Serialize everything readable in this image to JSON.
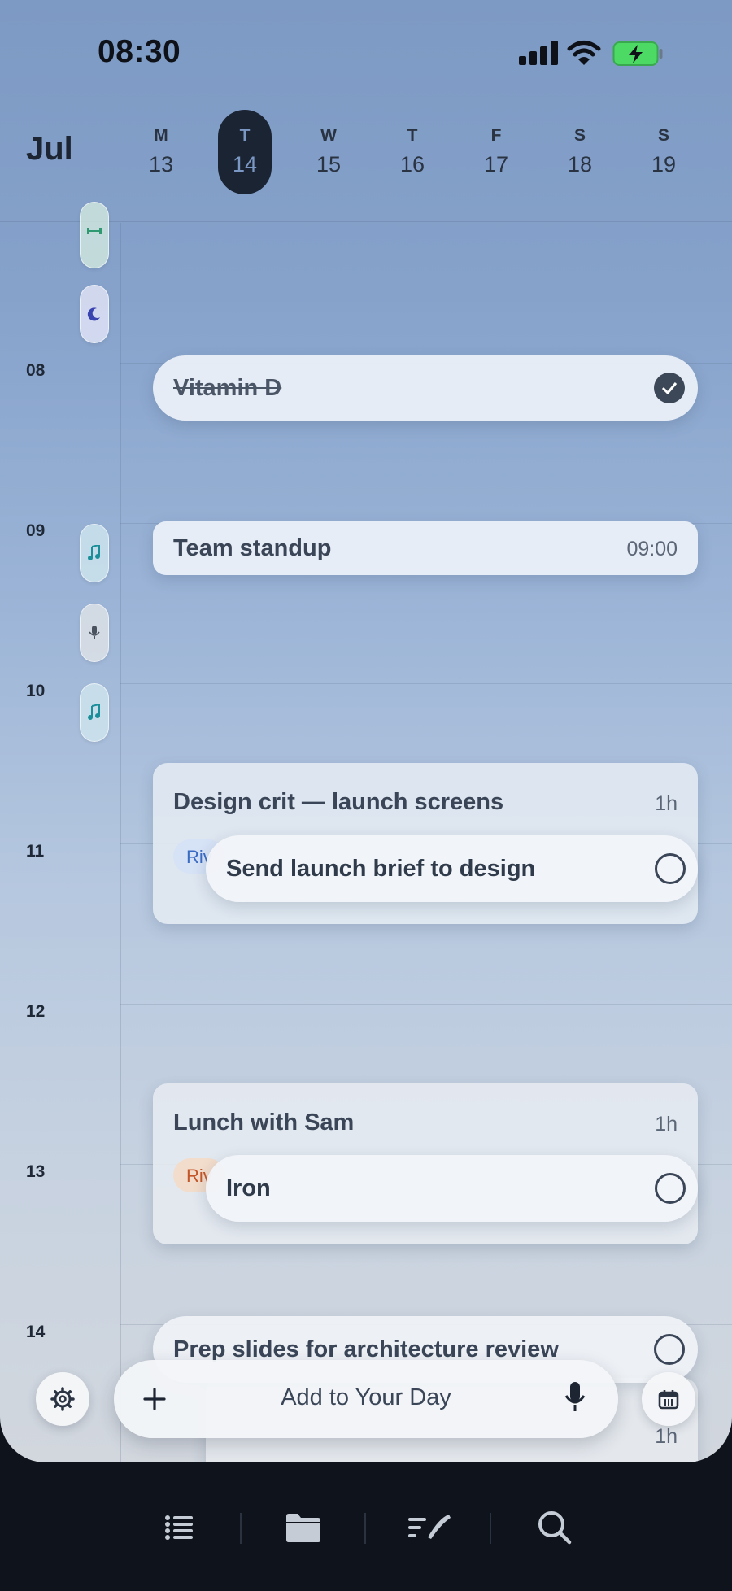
{
  "status_bar": {
    "time": "08:30"
  },
  "header": {
    "month": "Jul",
    "days": [
      {
        "letter": "M",
        "num": "13"
      },
      {
        "letter": "T",
        "num": "14",
        "selected": true
      },
      {
        "letter": "W",
        "num": "15"
      },
      {
        "letter": "T",
        "num": "16"
      },
      {
        "letter": "F",
        "num": "17"
      },
      {
        "letter": "S",
        "num": "18"
      },
      {
        "letter": "S",
        "num": "19"
      }
    ]
  },
  "timeline": {
    "hours": [
      "08",
      "09",
      "10",
      "11",
      "12",
      "13",
      "14"
    ],
    "habit_icons": [
      "dumbbell-icon",
      "moon-icon",
      "music-note-icon",
      "microphone-icon",
      "music-note-icon"
    ]
  },
  "items": {
    "vitamin": {
      "title": "Vitamin D",
      "done": true
    },
    "standup": {
      "title": "Team standup",
      "time": "09:00"
    },
    "design_crit": {
      "title": "Design crit — launch screens",
      "duration": "1h",
      "tag": "Riv"
    },
    "launch_brief": {
      "title": "Send launch brief to design"
    },
    "lunch": {
      "title": "Lunch with Sam",
      "duration": "1h",
      "tag": "Riv"
    },
    "iron": {
      "title": "Iron"
    },
    "prep_slides": {
      "title": "Prep slides for architecture review"
    },
    "hidden_card": {
      "duration": "1h"
    }
  },
  "composer": {
    "placeholder": "Add to Your Day"
  },
  "tabbar": [
    "list-icon",
    "folder-icon",
    "journal-icon",
    "search-icon"
  ],
  "colors": {
    "accent_dark": "#1b2433",
    "tab_bar_bg": "#0f141c",
    "battery_green": "#4cd964"
  }
}
